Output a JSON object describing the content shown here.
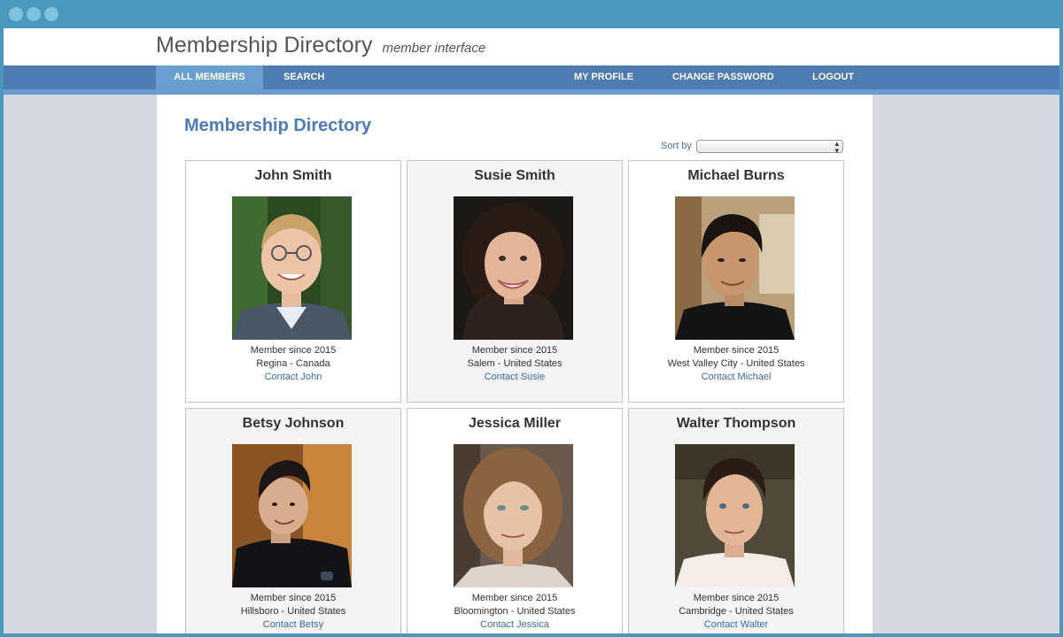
{
  "header": {
    "title": "Membership Directory",
    "subtitle": "member interface"
  },
  "nav": {
    "items": [
      {
        "label": "ALL MEMBERS",
        "active": true
      },
      {
        "label": "SEARCH"
      },
      {
        "label": "MY PROFILE"
      },
      {
        "label": "CHANGE PASSWORD"
      },
      {
        "label": "LOGOUT"
      }
    ]
  },
  "main": {
    "title": "Membership Directory",
    "sort_label": "Sort by",
    "sort_value": ""
  },
  "members": [
    {
      "name": "John Smith",
      "since": "Member since 2015",
      "location": "Regina - Canada",
      "contact": "Contact John"
    },
    {
      "name": "Susie Smith",
      "since": "Member since 2015",
      "location": "Salem - United States",
      "contact": "Contact Susie"
    },
    {
      "name": "Michael Burns",
      "since": "Member since 2015",
      "location": "West Valley City - United States",
      "contact": "Contact Michael"
    },
    {
      "name": "Betsy Johnson",
      "since": "Member since 2015",
      "location": "Hillsboro - United States",
      "contact": "Contact Betsy"
    },
    {
      "name": "Jessica Miller",
      "since": "Member since 2015",
      "location": "Bloomington - United States",
      "contact": "Contact Jessica"
    },
    {
      "name": "Walter Thompson",
      "since": "Member since 2015",
      "location": "Cambridge - United States",
      "contact": "Contact Walter"
    }
  ],
  "colors": {
    "accent": "#4d7bb2",
    "nav_active": "#6a9ecf",
    "link": "#3d6a9f",
    "frame": "#4a98bd"
  }
}
